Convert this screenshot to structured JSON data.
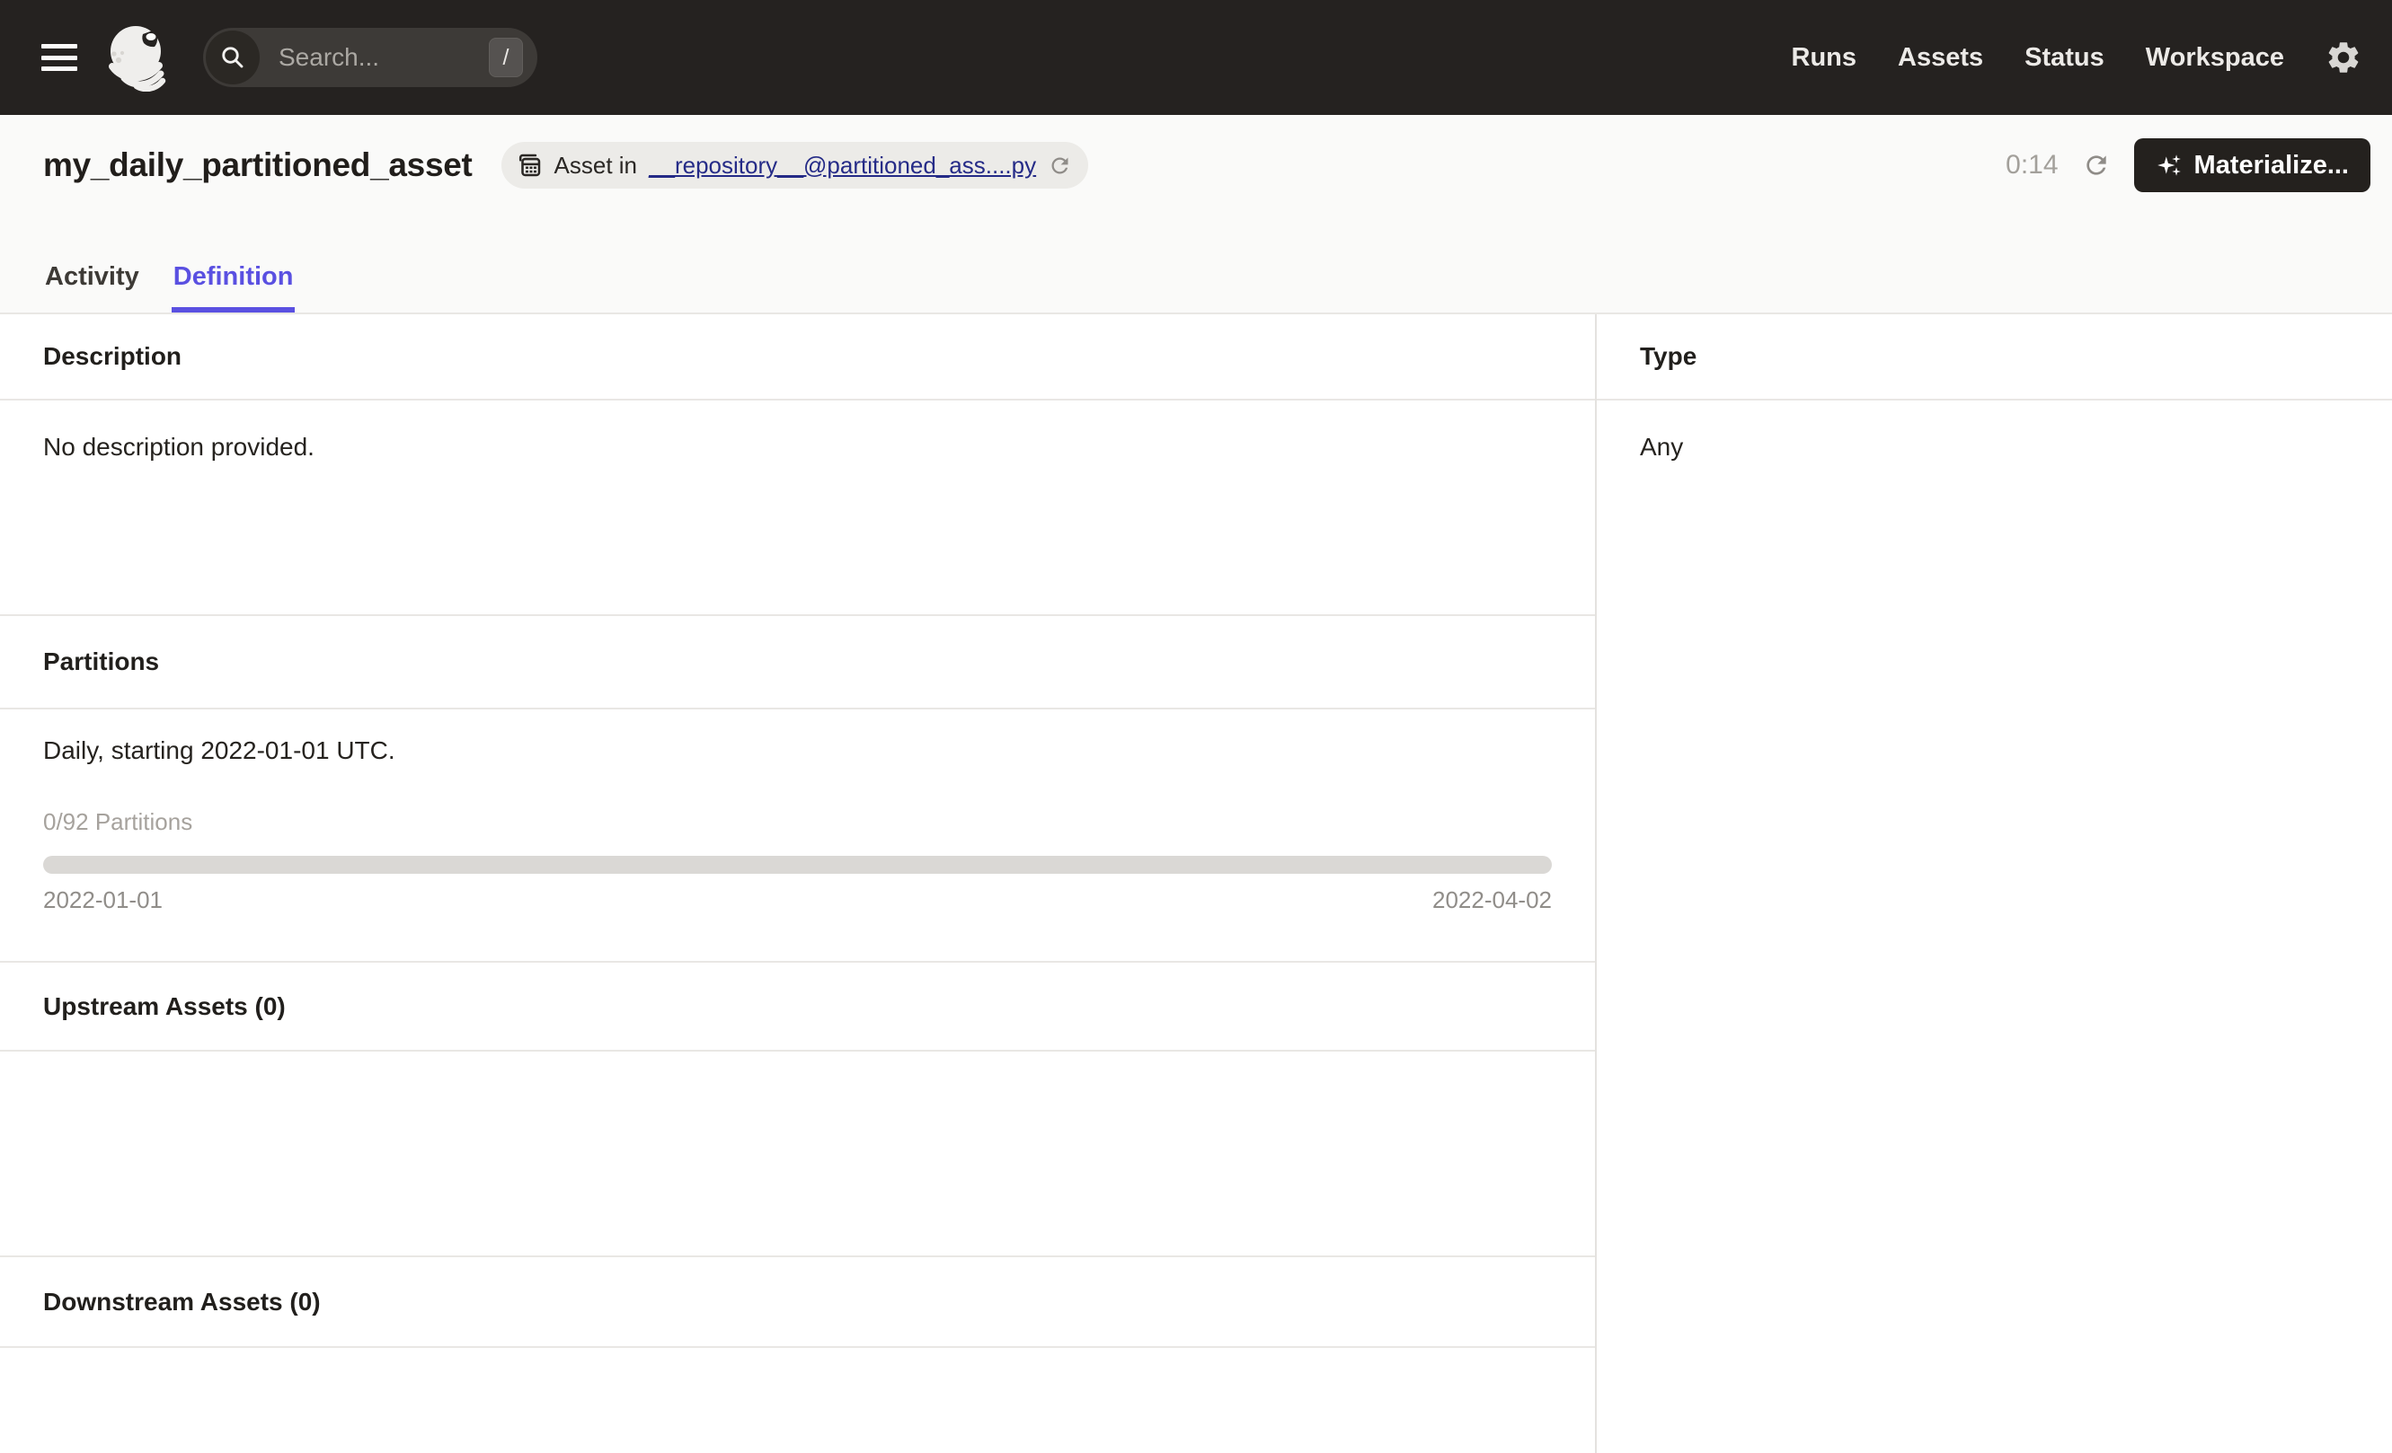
{
  "colors": {
    "navbar_bg": "#252220",
    "accent": "#5A50E1",
    "link": "#252B87",
    "header_bg": "#FAFAF9",
    "border": "#E9E7E4",
    "progress_track": "#DAD8D5",
    "materialize_bg": "#24211E"
  },
  "icons": {
    "menu": "hamburger-icon",
    "logo": "dagster-octopus-logo",
    "search": "magnifier-icon",
    "shortcut_key": "/",
    "gear": "gear-icon",
    "asset": "asset-table-icon",
    "reload": "circular-arrow-icon",
    "sparkle": "four-point-star-icon"
  },
  "navbar": {
    "search": {
      "placeholder": "Search...",
      "shortcut": "/"
    },
    "items": [
      {
        "label": "Runs"
      },
      {
        "label": "Assets"
      },
      {
        "label": "Status"
      },
      {
        "label": "Workspace"
      }
    ]
  },
  "header": {
    "title": "my_daily_partitioned_asset",
    "badge": {
      "prefix": "Asset in",
      "link_label": "__repository__@partitioned_ass....py"
    },
    "timer": "0:14",
    "materialize_label": "Materialize..."
  },
  "tabs": [
    {
      "label": "Activity",
      "active": false
    },
    {
      "label": "Definition",
      "active": true
    }
  ],
  "main": {
    "description": {
      "heading": "Description",
      "body": "No description provided."
    },
    "partitions": {
      "heading": "Partitions",
      "summary": "Daily, starting 2022-01-01 UTC.",
      "progress_label": "0/92 Partitions",
      "progress_percent": 0,
      "range_start": "2022-01-01",
      "range_end": "2022-04-02"
    },
    "upstream": {
      "heading": "Upstream Assets (0)"
    },
    "downstream": {
      "heading": "Downstream Assets (0)"
    },
    "type": {
      "heading": "Type",
      "value": "Any"
    }
  }
}
